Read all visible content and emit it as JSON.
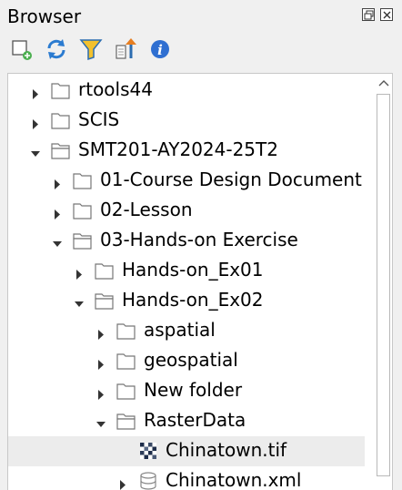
{
  "panel": {
    "title": "Browser"
  },
  "toolbar": {
    "buttons": [
      {
        "icon": "add-layer-icon"
      },
      {
        "icon": "refresh-icon"
      },
      {
        "icon": "filter-icon"
      },
      {
        "icon": "collapse-all-icon"
      },
      {
        "icon": "info-icon"
      }
    ]
  },
  "tree": {
    "items": [
      {
        "label": "rtools44",
        "expanded": false,
        "type": "folder"
      },
      {
        "label": "SCIS",
        "expanded": false,
        "type": "folder"
      },
      {
        "label": "SMT201-AY2024-25T2",
        "expanded": true,
        "type": "folder"
      },
      {
        "label": "01-Course Design Document",
        "expanded": false,
        "type": "folder"
      },
      {
        "label": "02-Lesson",
        "expanded": false,
        "type": "folder"
      },
      {
        "label": "03-Hands-on Exercise",
        "expanded": true,
        "type": "folder"
      },
      {
        "label": "Hands-on_Ex01",
        "expanded": false,
        "type": "folder"
      },
      {
        "label": "Hands-on_Ex02",
        "expanded": true,
        "type": "folder"
      },
      {
        "label": "aspatial",
        "expanded": false,
        "type": "folder"
      },
      {
        "label": "geospatial",
        "expanded": false,
        "type": "folder"
      },
      {
        "label": "New folder",
        "expanded": false,
        "type": "folder"
      },
      {
        "label": "RasterData",
        "expanded": true,
        "type": "folder"
      },
      {
        "label": "Chinatown.tif",
        "type": "raster",
        "selected": true
      },
      {
        "label": "Chinatown.xml",
        "expanded": false,
        "type": "database"
      }
    ]
  }
}
